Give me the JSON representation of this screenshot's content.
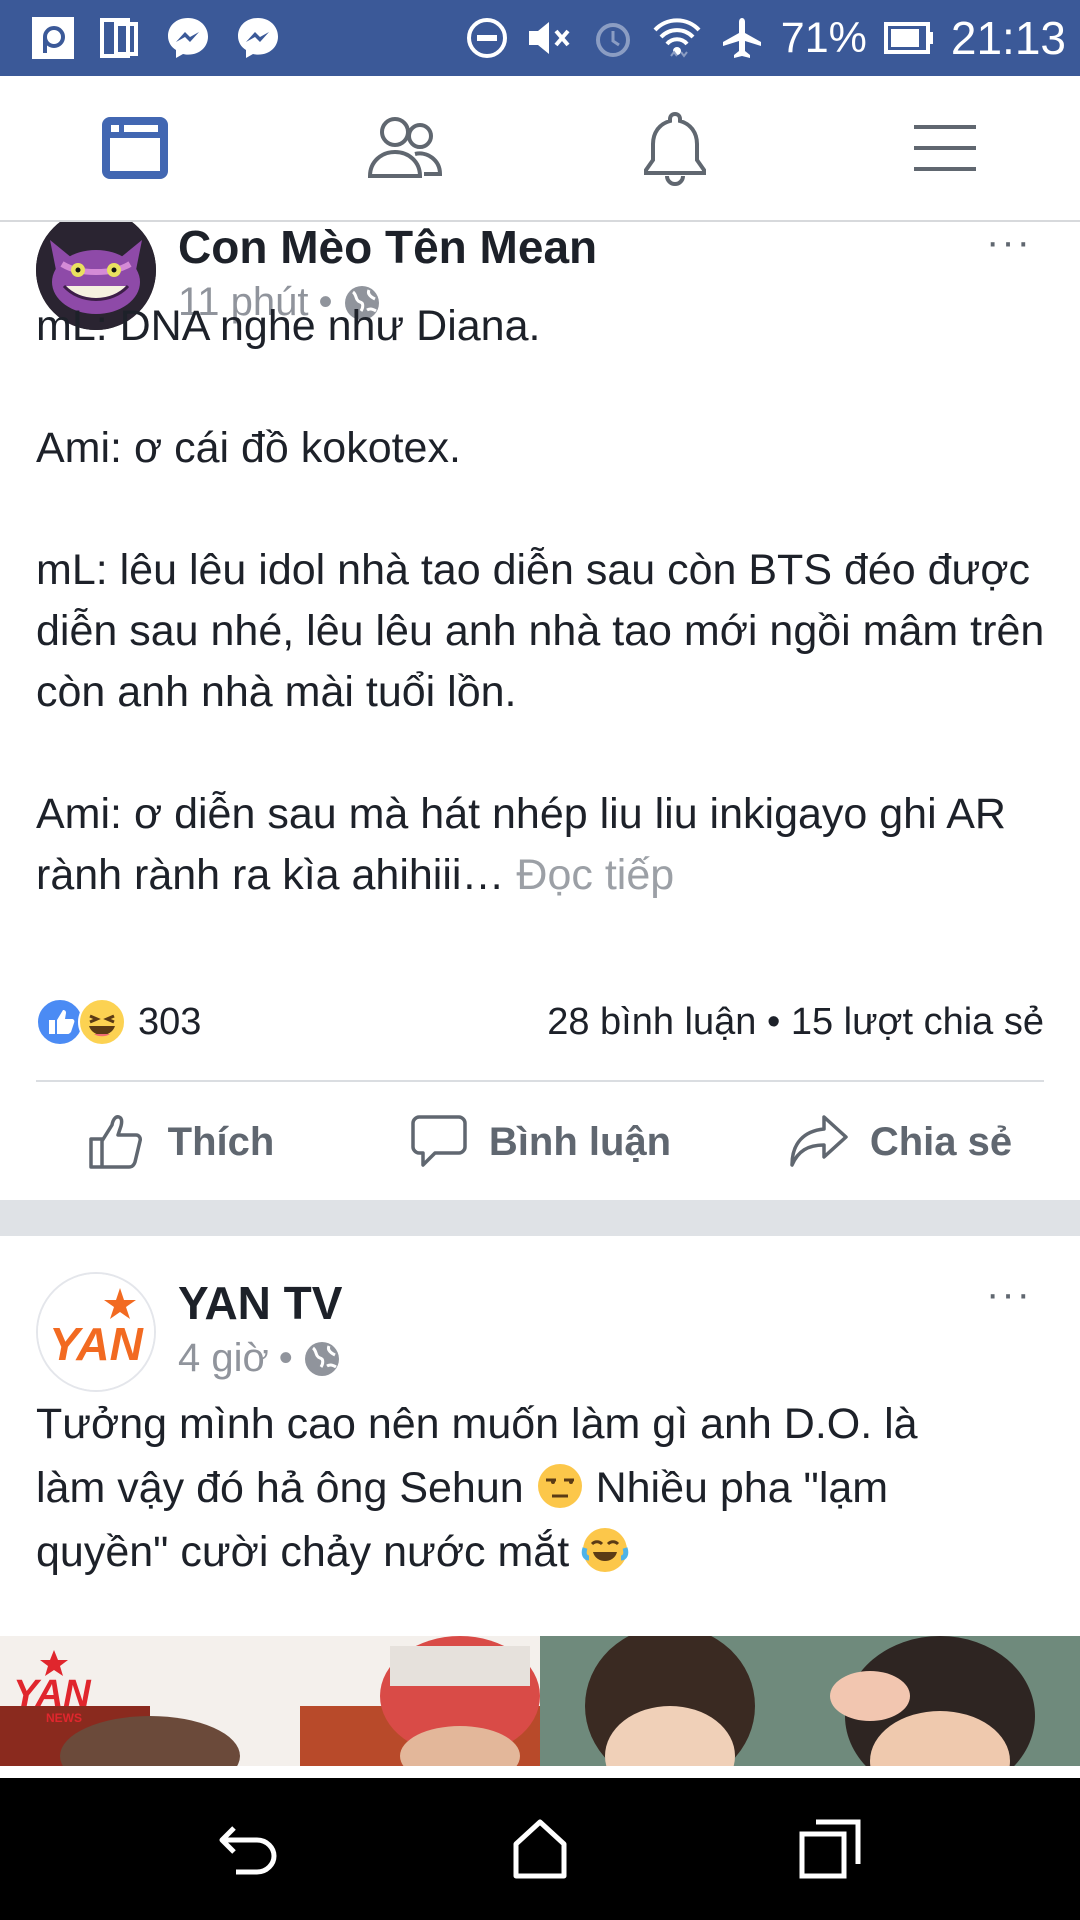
{
  "status_bar": {
    "battery_percent": "71%",
    "time": "21:13"
  },
  "navbar": {
    "tabs": [
      {
        "icon": "news-feed-icon",
        "active": true
      },
      {
        "icon": "friends-icon",
        "active": false
      },
      {
        "icon": "notifications-icon",
        "active": false
      },
      {
        "icon": "menu-icon",
        "active": false
      }
    ],
    "accent_color": "#4267b2"
  },
  "posts": [
    {
      "author": "Con Mèo Tên Mean",
      "time": "11 phút",
      "separator": "•",
      "privacy_icon": "globe-icon",
      "more": "···",
      "paragraphs": [
        "mL: DNA nghe như Diana.",
        "Ami: ơ cái đồ kokotex.",
        "mL: lêu lêu idol nhà tao diễn sau còn BTS đéo được diễn sau nhé, lêu lêu anh nhà tao mới ngồi mâm trên còn anh nhà mài tuổi lồn.",
        "Ami: ơ diễn sau mà hát nhép liu liu inkigayo ghi AR rành rành ra kìa ahihiii…"
      ],
      "read_more": "Đọc tiếp",
      "reaction_count": "303",
      "comments": "28 bình luận",
      "shares": "15 lượt chia sẻ",
      "stats_separator": "•",
      "actions": {
        "like": "Thích",
        "comment": "Bình luận",
        "share": "Chia sẻ"
      }
    },
    {
      "author": "YAN TV",
      "time": "4 giờ",
      "separator": "•",
      "privacy_icon": "globe-icon",
      "more": "···",
      "text_line1": "Tưởng mình cao nên muốn làm gì anh D.O. là",
      "text_line2a": "làm vậy đó hả ông Sehun ",
      "text_line2b": " Nhiều pha \"lạm",
      "text_line3": "quyền\" cười chảy nước mắt ",
      "logo_text": "YAN",
      "image_logo_text": "YAN",
      "image_logo_sub": "NEWS"
    }
  ],
  "android_nav": {
    "buttons": [
      "back-icon",
      "home-icon",
      "recents-icon"
    ]
  }
}
